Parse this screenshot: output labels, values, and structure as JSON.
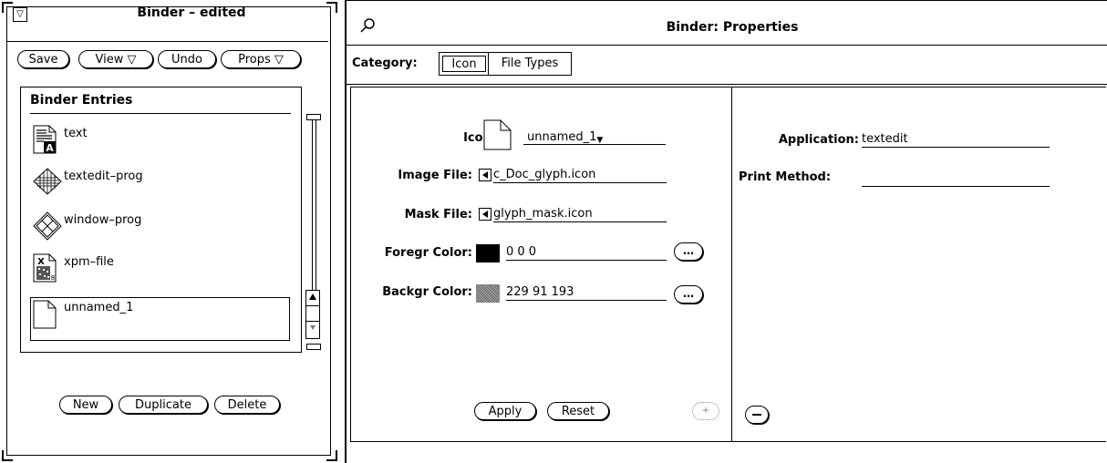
{
  "binder": {
    "title": "Binder – edited",
    "menu_glyph": "▽",
    "buttons": {
      "save": "Save",
      "view": "View ▽",
      "undo": "Undo",
      "props": "Props ▽"
    },
    "list_header": "Binder Entries",
    "entries": [
      {
        "label": "text",
        "icon": "text-doc-icon"
      },
      {
        "label": "textedit–prog",
        "icon": "textedit-prog-icon"
      },
      {
        "label": "window–prog",
        "icon": "window-prog-icon"
      },
      {
        "label": "xpm–file",
        "icon": "xpm-file-icon"
      },
      {
        "label": "unnamed_1",
        "icon": "blank-doc-icon"
      }
    ],
    "footer_buttons": {
      "new": "New",
      "duplicate": "Duplicate",
      "delete": "Delete"
    }
  },
  "props": {
    "title": "Binder: Properties",
    "pushpin_icon": "pushpin-icon",
    "category_label": "Category:",
    "category_options": [
      "Icon",
      "File Types"
    ],
    "category_selected": "Icon",
    "icon_label": "Icon:",
    "icon_name": "unnamed_1",
    "image_file_label": "Image File:",
    "image_file_value": "c_Doc_glyph.icon",
    "mask_file_label": "Mask File:",
    "mask_file_value": "glyph_mask.icon",
    "fg_label": "Foregr Color:",
    "fg_value": "0 0 0",
    "bg_label": "Backgr Color:",
    "bg_value": "229 91 193",
    "ellipsis": "…",
    "apply": "Apply",
    "reset": "Reset",
    "application_label": "Application:",
    "application_value": "textedit",
    "print_method_label": "Print Method:",
    "print_method_value": "",
    "colors": {
      "foreground_swatch": "#000000",
      "background_swatch": "#8c8c8c"
    }
  }
}
